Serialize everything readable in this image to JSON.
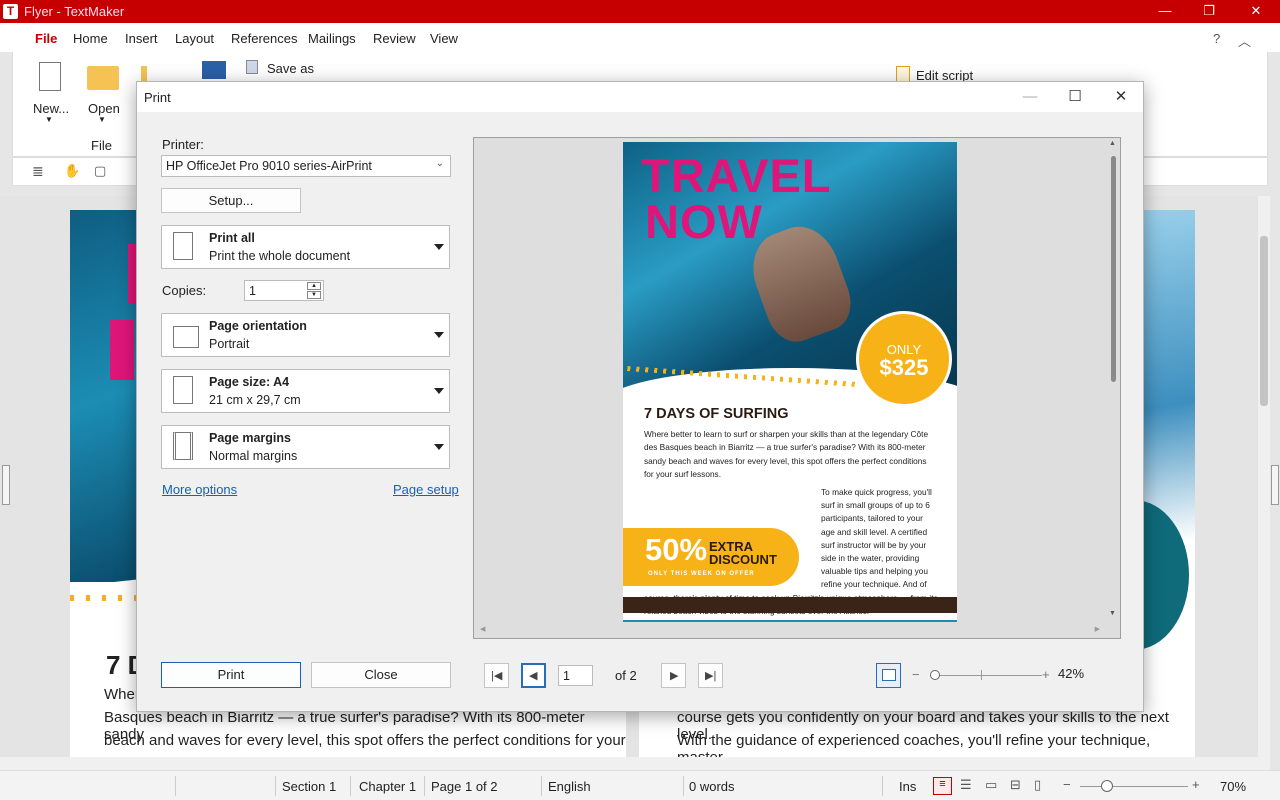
{
  "app": {
    "title": "Flyer - TextMaker",
    "logo": "T"
  },
  "menu": [
    "File",
    "Home",
    "Insert",
    "Layout",
    "References",
    "Mailings",
    "Review",
    "View"
  ],
  "ribbon": {
    "new": "New...",
    "open": "Open",
    "save_as": "Save as",
    "edit_script": "Edit script",
    "group_file": "File"
  },
  "document": {
    "heading": "7 D",
    "line1": "Where",
    "line2": "Basques beach in Biarritz — a true surfer's paradise? With its 800-meter sandy",
    "line3": "beach and waves for every level, this spot offers the perfect conditions for your",
    "line4": "course gets you confidently on your board and takes your skills to the next level.",
    "line5": "With the guidance of experienced coaches, you'll refine your technique, master"
  },
  "status": {
    "section": "Section 1",
    "chapter": "Chapter 1",
    "page": "Page 1 of 2",
    "language": "English",
    "words": "0 words",
    "mode": "Ins",
    "zoom": "70%"
  },
  "dialog": {
    "title": "Print",
    "printer_label": "Printer:",
    "printer_value": "HP OfficeJet Pro 9010 series-AirPrint",
    "setup": "Setup...",
    "print_all_title": "Print all",
    "print_all_desc": "Print the whole document",
    "copies_label": "Copies:",
    "copies_value": "1",
    "orientation_title": "Page orientation",
    "orientation_value": "Portrait",
    "size_title": "Page size: A4",
    "size_value": "21 cm x 29,7 cm",
    "margins_title": "Page margins",
    "margins_value": "Normal margins",
    "more_options": "More options",
    "page_setup": "Page setup",
    "print_btn": "Print",
    "close_btn": "Close",
    "page_current": "1",
    "page_of": "of 2",
    "zoom": "42%"
  },
  "flyer": {
    "title1": "TRAVEL",
    "title2": "NOW",
    "price_top": "ONLY",
    "price": "$325",
    "heading": "7 DAYS OF SURFING",
    "p1": "Where better to learn to surf or sharpen your skills than at the legendary Côte des Basques beach in Biarritz — a true surfer's paradise? With its 800-meter sandy beach and waves for every level, this spot offers the perfect conditions for your surf lessons.",
    "p2": "To make quick progress, you'll surf in small groups of up to 6 participants, tailored to your age and skill level. A certified surf instructor will be by your side in the water, providing valuable tips and helping you refine your technique. And of course, there's plenty of time to soak up Biarritz's unique atmosphere — from its relaxed beach vibes to the stunning sunsets over the Atlantic.",
    "discount_big": "50%",
    "discount_word1": "EXTRA",
    "discount_word2": "DISCOUNT",
    "discount_small": "ONLY THIS WEEK ON OFFER"
  },
  "colors": {
    "accent": "#c60000",
    "magenta": "#e0157a",
    "gold": "#f7b218",
    "brown": "#3a2418",
    "link": "#1a5fb4"
  }
}
